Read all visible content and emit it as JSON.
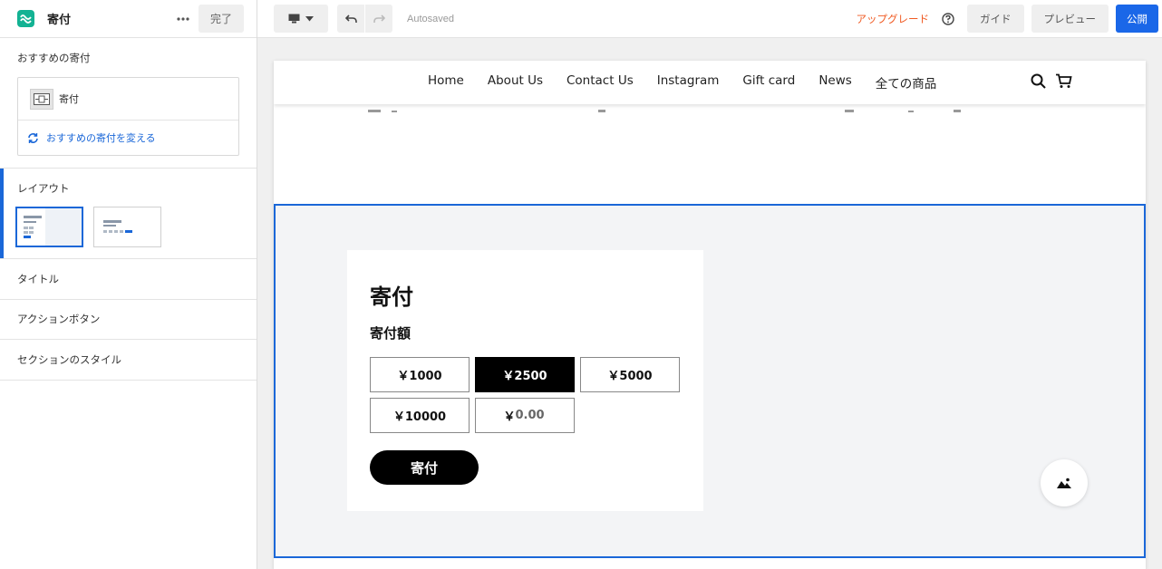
{
  "sidebar": {
    "title": "寄付",
    "done_label": "完了",
    "recommended": {
      "label": "おすすめの寄付",
      "item_name": "寄付",
      "change_label": "おすすめの寄付を変える"
    },
    "layout_label": "レイアウト",
    "rows": [
      "タイトル",
      "アクションボタン",
      "セクションのスタイル"
    ]
  },
  "topbar": {
    "autosaved": "Autosaved",
    "upgrade": "アップグレード",
    "guide": "ガイド",
    "preview": "プレビュー",
    "publish": "公開"
  },
  "site": {
    "nav": [
      "Home",
      "About Us",
      "Contact Us",
      "Instagram",
      "Gift card",
      "News",
      "全ての商品"
    ]
  },
  "donation": {
    "title": "寄付",
    "amount_label": "寄付額",
    "amounts": [
      "￥1000",
      "￥2500",
      "￥5000",
      "￥10000"
    ],
    "selected_amount": "￥2500",
    "currency_symbol": "￥",
    "custom_placeholder": "0.00",
    "button_label": "寄付"
  },
  "colors": {
    "accent": "#1a67d8",
    "brand": "#13b293",
    "upgrade": "#f05a22"
  }
}
